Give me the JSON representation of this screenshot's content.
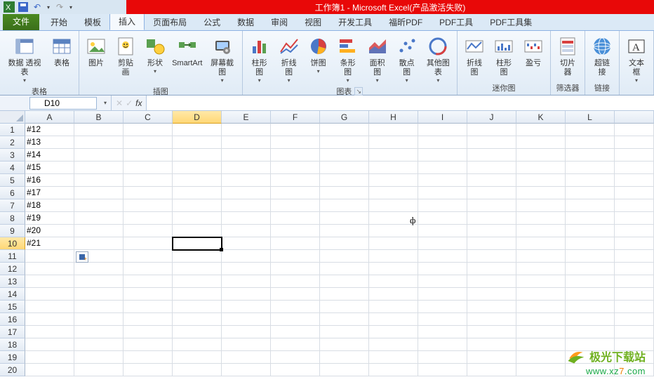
{
  "title_center": "工作簿1 - Microsoft Excel(产品激活失败)",
  "tabs": {
    "file": "文件",
    "items": [
      "开始",
      "模板",
      "插入",
      "页面布局",
      "公式",
      "数据",
      "审阅",
      "视图",
      "开发工具",
      "福昕PDF",
      "PDF工具",
      "PDF工具集"
    ],
    "active_index": 2
  },
  "ribbon": {
    "groups": [
      {
        "label": "表格",
        "buttons": [
          {
            "label": "数据\n透视表",
            "icon": "pivot",
            "dd": true
          },
          {
            "label": "表格",
            "icon": "table"
          }
        ]
      },
      {
        "label": "插图",
        "buttons": [
          {
            "label": "图片",
            "icon": "picture"
          },
          {
            "label": "剪贴画",
            "icon": "clipart"
          },
          {
            "label": "形状",
            "icon": "shapes",
            "dd": true
          },
          {
            "label": "SmartArt",
            "icon": "smartart"
          },
          {
            "label": "屏幕截图",
            "icon": "screenshot",
            "dd": true
          }
        ]
      },
      {
        "label": "图表",
        "launcher": true,
        "buttons": [
          {
            "label": "柱形图",
            "icon": "column-chart",
            "dd": true
          },
          {
            "label": "折线图",
            "icon": "line-chart",
            "dd": true
          },
          {
            "label": "饼图",
            "icon": "pie-chart",
            "dd": true
          },
          {
            "label": "条形图",
            "icon": "bar-chart",
            "dd": true
          },
          {
            "label": "面积图",
            "icon": "area-chart",
            "dd": true
          },
          {
            "label": "散点图",
            "icon": "scatter-chart",
            "dd": true
          },
          {
            "label": "其他图表",
            "icon": "other-chart",
            "dd": true
          }
        ]
      },
      {
        "label": "迷你图",
        "buttons": [
          {
            "label": "折线图",
            "icon": "sparkline-line"
          },
          {
            "label": "柱形图",
            "icon": "sparkline-column"
          },
          {
            "label": "盈亏",
            "icon": "sparkline-winloss"
          }
        ]
      },
      {
        "label": "筛选器",
        "buttons": [
          {
            "label": "切片器",
            "icon": "slicer"
          }
        ]
      },
      {
        "label": "链接",
        "buttons": [
          {
            "label": "超链接",
            "icon": "hyperlink"
          }
        ]
      },
      {
        "label": "",
        "buttons": [
          {
            "label": "文本框",
            "icon": "textbox",
            "dd": true
          }
        ]
      }
    ]
  },
  "name_box": "D10",
  "fx_label": "fx",
  "columns": [
    "A",
    "B",
    "C",
    "D",
    "E",
    "F",
    "G",
    "H",
    "I",
    "J",
    "K",
    "L"
  ],
  "selected_col_index": 3,
  "selected_row_index": 9,
  "row_count": 20,
  "cells": {
    "A1": "#12",
    "A2": "#13",
    "A3": "#14",
    "A4": "#15",
    "A5": "#16",
    "A6": "#17",
    "A7": "#18",
    "A8": "#19",
    "A9": "#20",
    "A10": "#21"
  },
  "cursor_symbol": "ф",
  "watermark": {
    "text": "极光下载站",
    "url_prefix": "www.xz",
    "url_seven": "7",
    "url_suffix": ".com"
  }
}
